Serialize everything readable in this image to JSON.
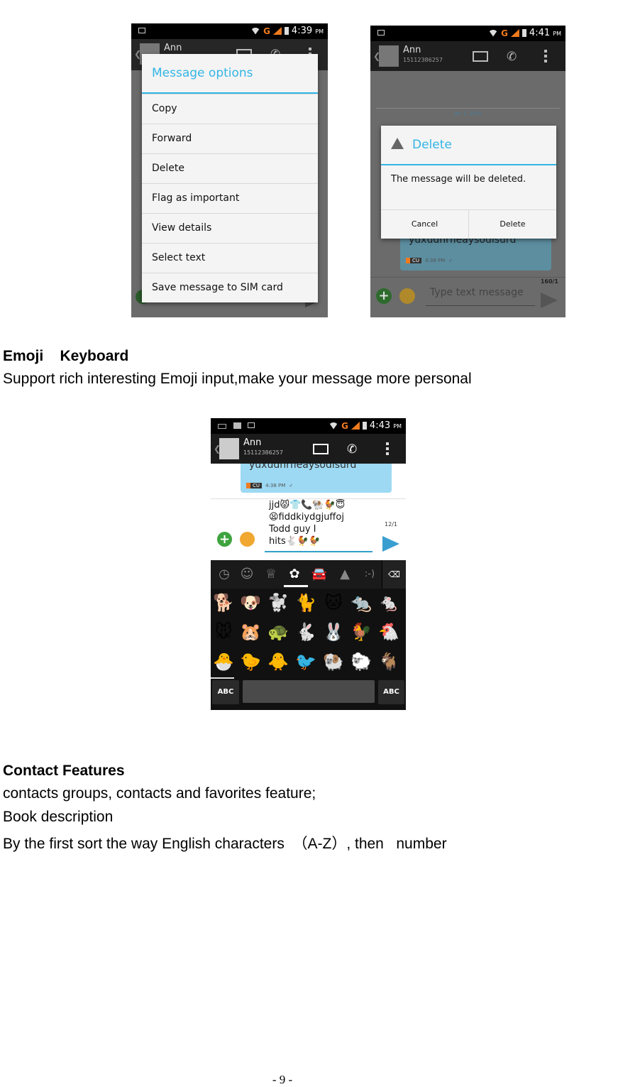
{
  "screen1": {
    "status_time": "4:39",
    "status_ampm": "PM",
    "network": "G",
    "contact_name": "Ann",
    "dialog_title": "Message options",
    "menu_items": [
      "Copy",
      "Forward",
      "Delete",
      "Flag as important",
      "View details",
      "Select text",
      "Save message to SIM card"
    ]
  },
  "screen2": {
    "status_time": "4:41",
    "status_ampm": "PM",
    "network": "G",
    "contact_name": "Ann",
    "contact_number": "15112386257",
    "date_divider": "Jan 1, 2010",
    "dialog_title": "Delete",
    "dialog_message": "The message will be deleted.",
    "cancel_label": "Cancel",
    "delete_label": "Delete",
    "message_text": "yuxudhrfieaysodisurd",
    "carrier_tag": "CU",
    "message_time": "4:38 PM",
    "char_counter": "160/1",
    "input_placeholder": "Type text message"
  },
  "screen3": {
    "status_time": "4:43",
    "status_ampm": "PM",
    "network": "G",
    "contact_name": "Ann",
    "contact_number": "15112386257",
    "message_text": "yuxudhrfieaysodisurd",
    "carrier_tag": "CU",
    "message_time": "4:38 PM",
    "char_counter": "12/1",
    "compose_lines": [
      "jjd😾👕📞🐏🐓😇",
      "😫fiddkiydgjuffoj",
      "Todd guy I",
      "hits🐇🐓🐓"
    ],
    "keyboard_tabs": [
      "recent-icon",
      "smiley-icon",
      "crown-icon",
      "flower-icon",
      "car-icon",
      "triangle-icon",
      "emoticon-icon"
    ],
    "emoticon_tab_label": ":-)",
    "emoji_rows": [
      [
        "🐕",
        "🐶",
        "🐩",
        "🐈",
        "🐱",
        "🐀",
        "🐁"
      ],
      [
        "🐭",
        "🐹",
        "🐢",
        "🐇",
        "🐰",
        "🐓",
        "🐔"
      ],
      [
        "🐣",
        "🐤",
        "🐥",
        "🐦",
        "🐏",
        "🐑",
        "🐐"
      ]
    ],
    "abc_left": "ABC",
    "abc_right": "ABC"
  },
  "document": {
    "emoji_heading": "Emoji    Keyboard",
    "emoji_desc": "Support rich interesting Emoji input,make your message more personal",
    "contact_heading": "Contact Features",
    "contact_lines": [
      "contacts groups, contacts and favorites feature;",
      "Book description",
      "By the first sort the way English characters  （A-Z）, then   number"
    ],
    "page_number": "- 9 -"
  }
}
